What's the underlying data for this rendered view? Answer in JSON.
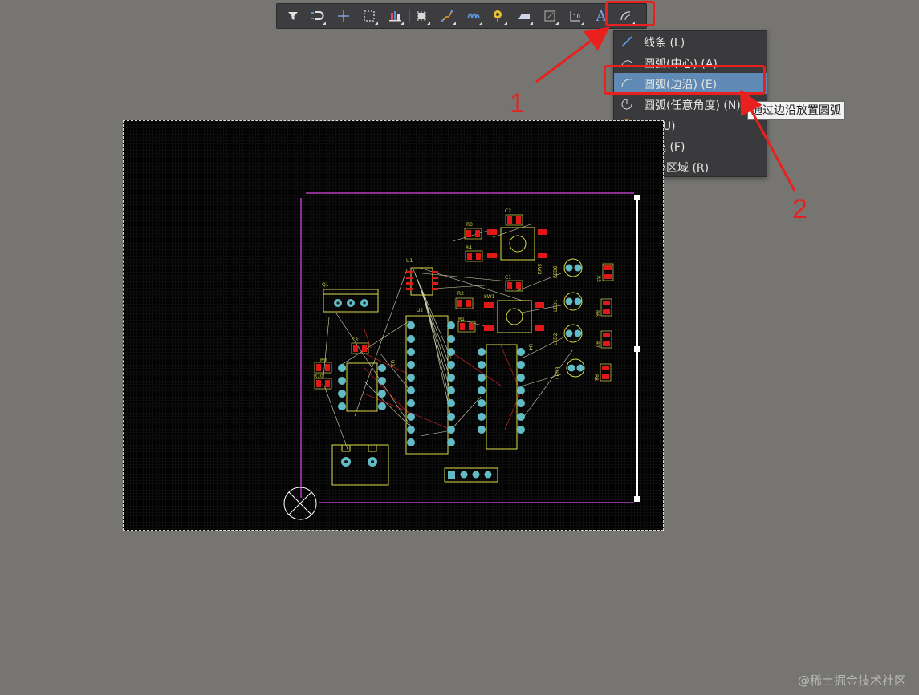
{
  "toolbar": {
    "tools": [
      {
        "name": "filter-icon"
      },
      {
        "name": "route-select-icon"
      },
      {
        "name": "crosshair-icon"
      },
      {
        "name": "selection-box-icon"
      },
      {
        "name": "align-icon"
      },
      {
        "name": "component-icon"
      },
      {
        "name": "interactive-route-icon"
      },
      {
        "name": "diff-pair-icon"
      },
      {
        "name": "via-icon"
      },
      {
        "name": "polygon-icon"
      },
      {
        "name": "keepout-icon"
      },
      {
        "name": "dimension-icon"
      },
      {
        "name": "text-icon",
        "label": "A"
      },
      {
        "name": "arc-icon"
      }
    ]
  },
  "menu": {
    "items": [
      {
        "label": "线条 (L)",
        "icon": "line-icon"
      },
      {
        "label": "圆弧(中心) (A)",
        "icon": "arc-center-icon"
      },
      {
        "label": "圆弧(边沿) (E)",
        "icon": "arc-edge-icon",
        "highlighted": true
      },
      {
        "label": "圆弧(任意角度) (N)",
        "icon": "arc-any-angle-icon"
      },
      {
        "label": "圆 (U)",
        "icon": "circle-icon"
      },
      {
        "label": "填充 (F)",
        "icon": "fill-icon"
      },
      {
        "label": "实心区域 (R)",
        "icon": "solid-region-icon"
      }
    ]
  },
  "tooltip": "通过边沿放置圆弧",
  "annotations": {
    "step1": "1",
    "step2": "2"
  },
  "pcb": {
    "designators": {
      "q1": "Q1",
      "r3": "R3",
      "r4": "R4",
      "c2": "C2",
      "u1": "U1",
      "sw2": "SW2",
      "c1": "C1",
      "r2": "R2",
      "sw1": "SW1",
      "u2": "U2",
      "r1": "R1",
      "c3": "C3",
      "u3": "U3",
      "r9": "R9",
      "r10": "R10",
      "u4": "U4",
      "led0": "LED0",
      "r5": "R5",
      "led1": "LED1",
      "r6": "R6",
      "led2": "LED2",
      "r7": "R7",
      "led3": "LED3",
      "r8": "R8"
    }
  },
  "colors": {
    "background": "#767572",
    "toolbar": "#3d3d3f",
    "menu": "#3a3a3c",
    "highlight": "#5e8ab5",
    "annotation": "#e8201e",
    "board_outline": "#b43cbe",
    "silkscreen": "#d9d94a",
    "pad": "#62bcc6",
    "smd_pad": "#e01818"
  },
  "watermark": "@稀土掘金技术社区"
}
